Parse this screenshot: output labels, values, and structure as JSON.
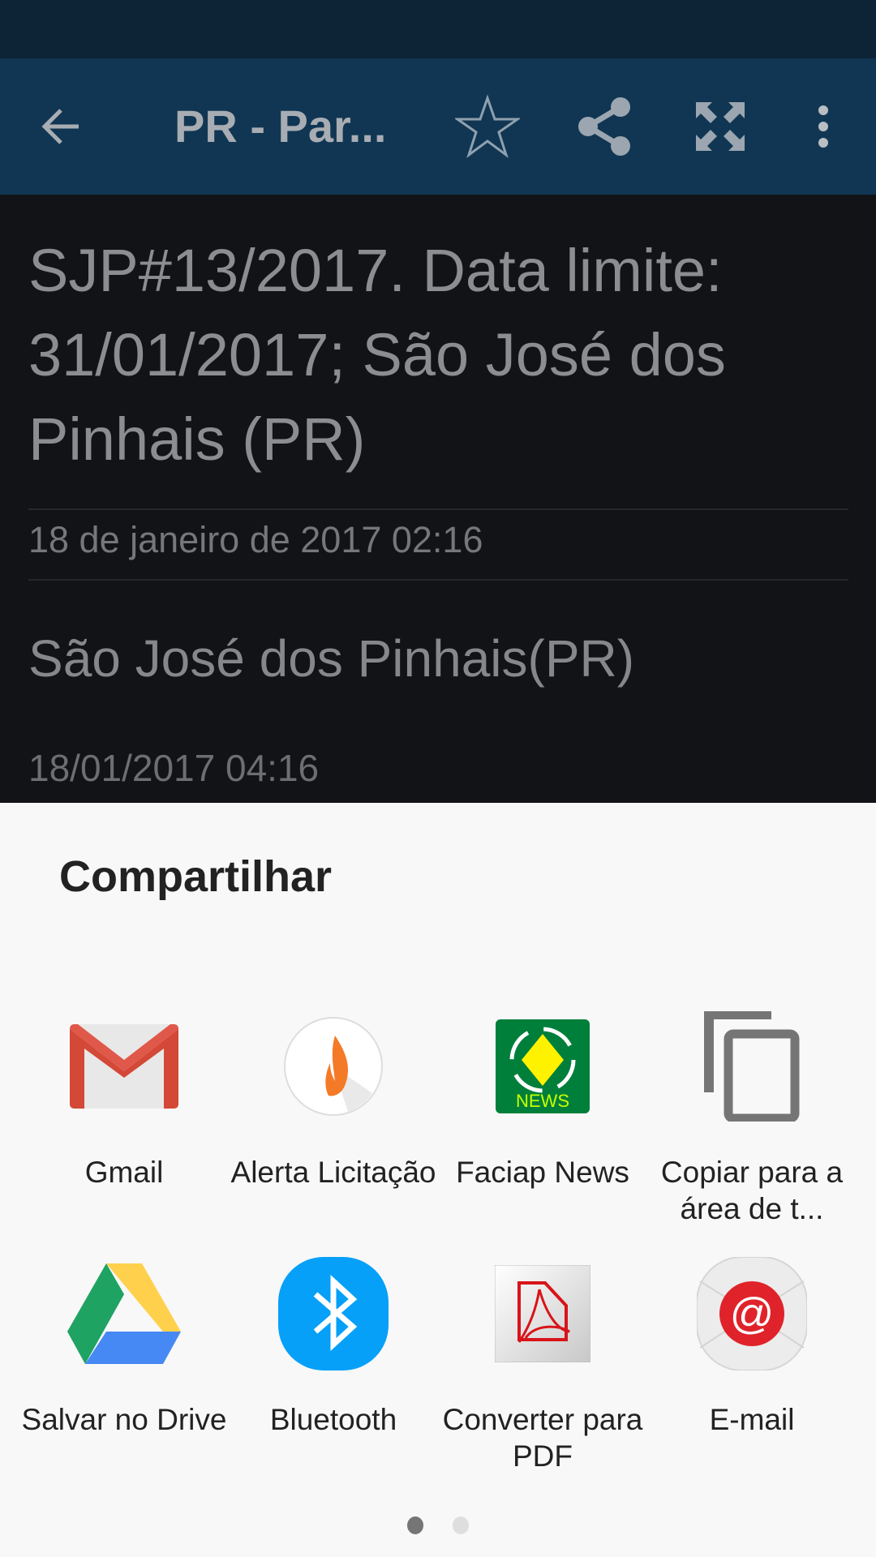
{
  "toolbar": {
    "title": "PR - Par...",
    "icons": [
      "back-arrow-icon",
      "star-icon",
      "share-icon",
      "fullscreen-icon",
      "more-vert-icon"
    ]
  },
  "article": {
    "headline": "SJP#13/2017. Data limite: 31/01/2017; São José dos Pinhais (PR)",
    "published": "18 de janeiro de 2017 02:16",
    "location": "São José dos Pinhais(PR)",
    "timestamp": "18/01/2017 04:16"
  },
  "share_sheet": {
    "title": "Compartilhar",
    "apps": [
      {
        "label": "Gmail",
        "icon": "gmail-icon"
      },
      {
        "label": "Alerta Licitação",
        "icon": "flame-icon"
      },
      {
        "label": "Faciap News",
        "icon": "faciap-news-icon"
      },
      {
        "label": "Copiar para a área de t...",
        "icon": "copy-icon"
      },
      {
        "label": "Salvar no Drive",
        "icon": "google-drive-icon"
      },
      {
        "label": "Bluetooth",
        "icon": "bluetooth-icon"
      },
      {
        "label": "Converter para PDF",
        "icon": "pdf-icon"
      },
      {
        "label": "E-mail",
        "icon": "email-at-icon"
      }
    ],
    "pages": {
      "current": 1,
      "total": 2
    }
  },
  "colors": {
    "toolbar": "#113653",
    "statusbar": "#0d2437",
    "bluetooth": "#06a0f8"
  }
}
